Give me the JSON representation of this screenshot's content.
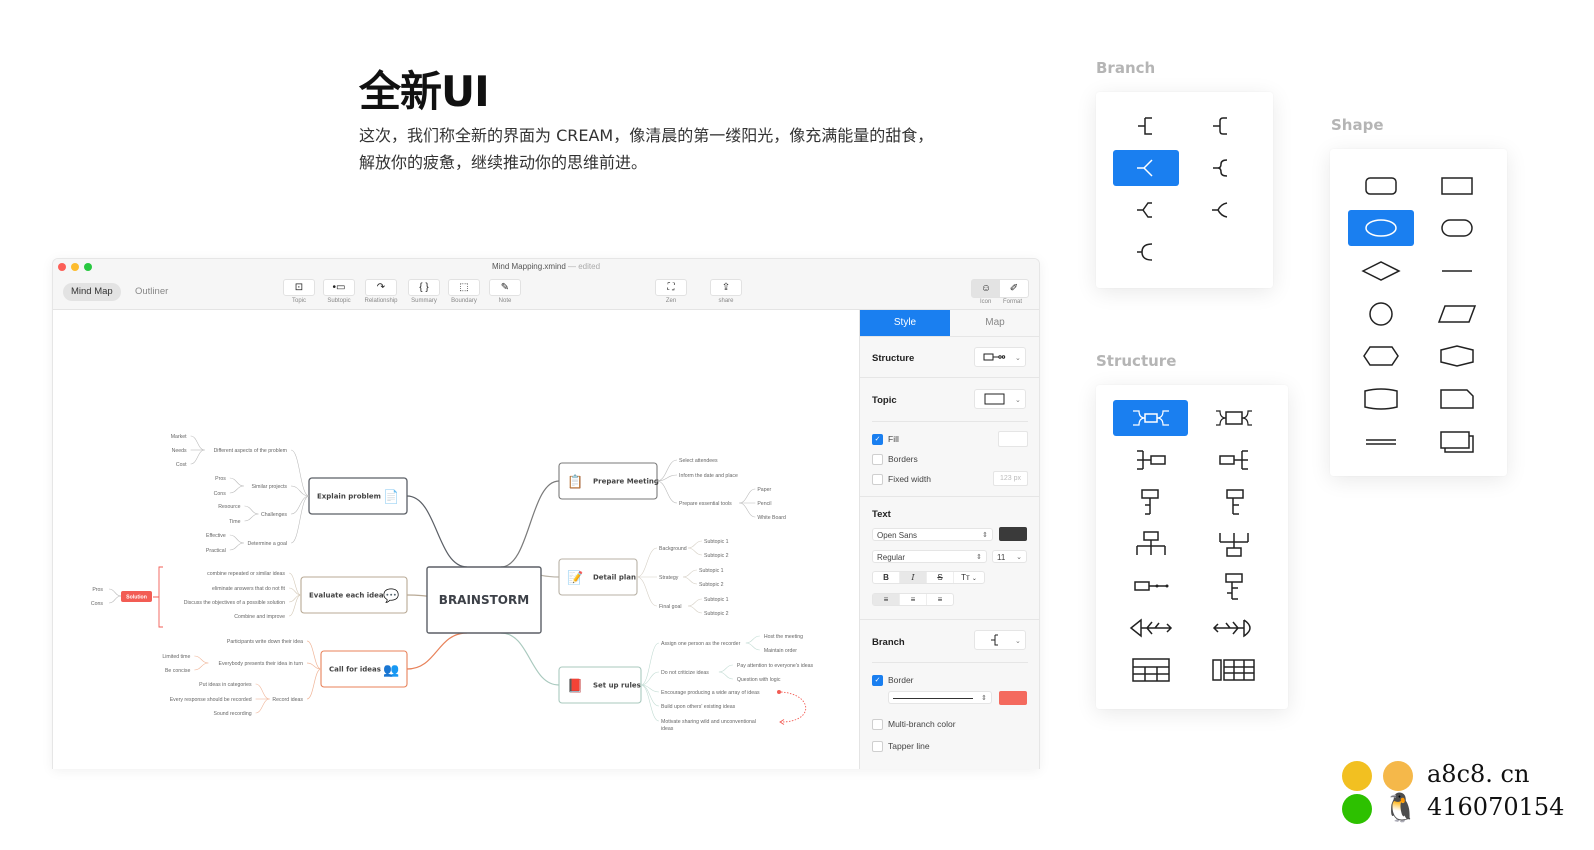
{
  "headline": "全新UI",
  "description": [
    "这次，我们称全新的界面为 CREAM，像清晨的第一缕阳光，像充满能量的甜食，",
    "解放你的疲惫，继续推动你的思维前进。"
  ],
  "window": {
    "title": "Mind Mapping.xmind",
    "title_status": "— edited",
    "view_tabs": [
      {
        "label": "Mind Map",
        "active": true
      },
      {
        "label": "Outliner",
        "active": false
      }
    ],
    "toolbar": [
      {
        "label": "Topic",
        "icon": "topic-icon",
        "glyph": "⊡"
      },
      {
        "label": "Subtopic",
        "icon": "subtopic-icon",
        "glyph": "•▭"
      },
      {
        "label": "Relationship",
        "icon": "relationship-icon",
        "glyph": "↷"
      },
      {
        "label": "Summary",
        "icon": "summary-icon",
        "glyph": "{ }"
      },
      {
        "label": "Boundary",
        "icon": "boundary-icon",
        "glyph": "⬚"
      },
      {
        "label": "Note",
        "icon": "note-icon",
        "glyph": "✎"
      },
      {
        "label": "Zen",
        "icon": "zen-icon",
        "glyph": "⛶"
      },
      {
        "label": "share",
        "icon": "share-icon",
        "glyph": "⇪"
      }
    ],
    "right_toggle": [
      {
        "label": "Icon",
        "glyph": "☺",
        "active": true
      },
      {
        "label": "Format",
        "glyph": "✐",
        "active": false
      }
    ]
  },
  "mindmap": {
    "central": "BRAINSTORM",
    "topics": {
      "explain": {
        "label": "Explain problem",
        "children": [
          {
            "label": "Different aspects of the problem",
            "children": [
              "Market",
              "Needs",
              "Cost"
            ]
          },
          {
            "label": "Similar projects",
            "children": [
              "Pros",
              "Cons"
            ]
          },
          {
            "label": "Challenges",
            "children": [
              "Resource",
              "Time"
            ]
          },
          {
            "label": "Determine a goal",
            "children": [
              "Effective",
              "Practical"
            ]
          }
        ]
      },
      "evaluate": {
        "label": "Evaluate each idea",
        "children": [
          "combine repeated or similar ideas",
          "eliminate answers that do not fit",
          "Discuss the objectives of a possible solution",
          "Combine and improve"
        ],
        "summary": "Solution",
        "summary_children": [
          "Pros",
          "Cons"
        ]
      },
      "call": {
        "label": "Call for ideas",
        "children": [
          {
            "label": "Participants write down their idea",
            "children": []
          },
          {
            "label": "Everybody presents their idea in turn",
            "children": [
              "Limited time",
              "Be concise"
            ]
          },
          {
            "label": "Record ideas",
            "children": [
              "Put ideas in categories",
              "Every response should be recorded",
              "Sound recording"
            ]
          }
        ]
      },
      "prepare": {
        "label": "Prepare Meeting",
        "children": [
          {
            "label": "Select attendees",
            "children": []
          },
          {
            "label": "Inform the date and place",
            "children": []
          },
          {
            "label": "Prepare essential tools",
            "children": [
              "Paper",
              "Pencil",
              "White Board"
            ]
          }
        ]
      },
      "detail": {
        "label": "Detail plan",
        "children": [
          {
            "label": "Background",
            "children": [
              "Subtopic 1",
              "Subtopic 2"
            ]
          },
          {
            "label": "Strategy",
            "children": [
              "Subtopic 1",
              "Subtopic 2"
            ]
          },
          {
            "label": "Final goal",
            "children": [
              "Subtopic 1",
              "Subtopic 2"
            ]
          }
        ]
      },
      "rules": {
        "label": "Set up rules",
        "children": [
          {
            "label": "Assign one person as the recorder",
            "children": [
              "Host the meeting",
              "Maintain order"
            ]
          },
          {
            "label": "Do not criticize ideas",
            "children": [
              "Pay attention to everyone's ideas",
              "Question with logic"
            ]
          },
          {
            "label": "Encourage producing a wide array of ideas",
            "children": []
          },
          {
            "label": "Build upon others' existing ideas",
            "children": []
          },
          {
            "label": "Motivate sharing wild and unconventional",
            "children": []
          },
          {
            "label": "ideas",
            "children": []
          }
        ]
      }
    },
    "colors": {
      "explain": "#5b5f66",
      "evaluate": "#b8a995",
      "call": "#e8825a",
      "prepare": "#7a7a7a",
      "detail": "#b9b2a6",
      "rules": "#a9c9be",
      "summary": "#f25c54"
    }
  },
  "panel": {
    "tabs": [
      {
        "label": "Style",
        "active": true
      },
      {
        "label": "Map",
        "active": false
      }
    ],
    "structure_label": "Structure",
    "topic_label": "Topic",
    "fill_label": "Fill",
    "fill_checked": true,
    "borders_label": "Borders",
    "borders_checked": false,
    "fixed_width_label": "Fixed width",
    "fixed_width_checked": false,
    "fixed_width_value": "123 px",
    "text_label": "Text",
    "font_family": "Open Sans",
    "font_weight": "Regular",
    "font_size": "11",
    "text_color": "#3a3a3a",
    "format_buttons": [
      "B",
      "I",
      "S",
      "Tт"
    ],
    "align_buttons": [
      "align-left",
      "align-center",
      "align-right"
    ],
    "branch_label": "Branch",
    "border_label": "Border",
    "border_checked": true,
    "border_color": "#f46a5e",
    "multi_branch_label": "Multi-branch color",
    "multi_branch_checked": false,
    "tapper_label": "Tapper line",
    "tapper_checked": false
  },
  "palettes": {
    "branch": {
      "title": "Branch",
      "selected_index": 2
    },
    "shape": {
      "title": "Shape",
      "selected_index": 2
    },
    "structure": {
      "title": "Structure",
      "selected_index": 0
    }
  },
  "accent_color": "#1a7ff0",
  "watermark": {
    "site": "a8c8. cn",
    "qq": "416070154"
  }
}
